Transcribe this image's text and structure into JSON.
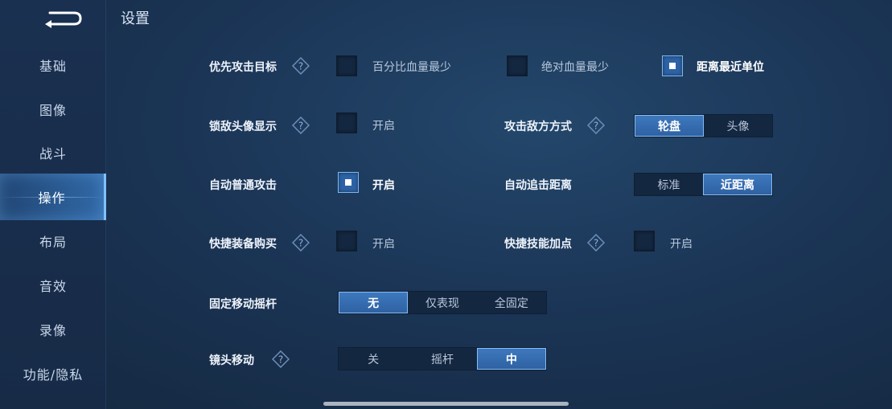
{
  "page": {
    "title": "设置"
  },
  "sidebar": {
    "items": [
      {
        "label": "基础"
      },
      {
        "label": "图像"
      },
      {
        "label": "战斗"
      },
      {
        "label": "操作",
        "active": true
      },
      {
        "label": "布局"
      },
      {
        "label": "音效"
      },
      {
        "label": "录像"
      },
      {
        "label": "功能/隐私"
      }
    ]
  },
  "settings": {
    "priority_target": {
      "label": "优先攻击目标",
      "options": [
        "百分比血量最少",
        "绝对血量最少",
        "距离最近单位"
      ],
      "selected": "距离最近单位"
    },
    "lock_avatar": {
      "label": "锁敌头像显示",
      "option": "开启",
      "checked": false
    },
    "attack_mode": {
      "label": "攻击敌方方式",
      "options": [
        "轮盘",
        "头像"
      ],
      "selected": "轮盘"
    },
    "auto_attack": {
      "label": "自动普通攻击",
      "option": "开启",
      "checked": true
    },
    "chase_distance": {
      "label": "自动追击距离",
      "options": [
        "标准",
        "近距离"
      ],
      "selected": "近距离"
    },
    "quick_buy": {
      "label": "快捷装备购买",
      "option": "开启",
      "checked": false
    },
    "quick_skill": {
      "label": "快捷技能加点",
      "option": "开启",
      "checked": false
    },
    "fixed_joystick": {
      "label": "固定移动摇杆",
      "options": [
        "无",
        "仅表现",
        "全固定"
      ],
      "selected": "无"
    },
    "camera_move": {
      "label": "镜头移动",
      "options": [
        "关",
        "摇杆",
        "中"
      ],
      "selected": "中"
    }
  },
  "colors": {
    "accent": "#2e62a3",
    "accent_border": "#86bdf5",
    "background": "#1b3556"
  }
}
